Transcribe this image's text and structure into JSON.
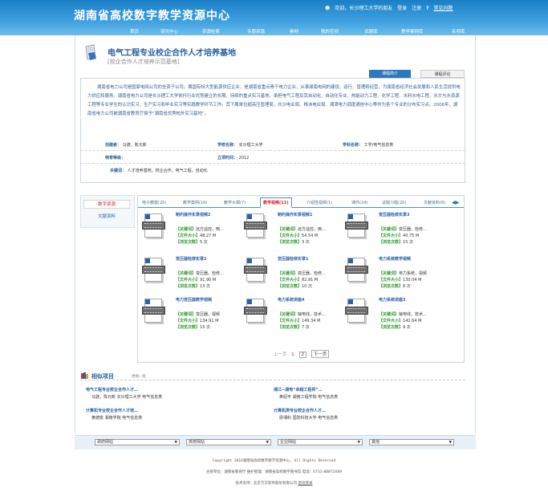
{
  "header": {
    "logo": "湖南省高校数字教学资源中心",
    "welcome": "欢迎，长沙理工大学的朋友",
    "login": "登录",
    "register": "注册",
    "help": "常见问题",
    "nav": [
      "首页",
      "资讯中心",
      "资源检索",
      "专题资源",
      "素材",
      "我的空间",
      "试题库",
      "教学案例库",
      "名师库"
    ]
  },
  "page": {
    "title": "电气工程专业校企合作人才培养基地",
    "subtitle": "[校企合作人才培养示范基地]",
    "tabs": [
      "课程简介",
      "课程评论"
    ]
  },
  "intro": {
    "text": "湖南省电力公司是国家电网公司的全资子公司。属国有特大型能源供应企业，是湖南省重点骨干电力企业，从事湖南电网的建设、运行、管理和经营，为湖南省经济社会发展和人民生活提供电力供应和服务。湖南省电力公司是长沙理工大学依托行业优势建立的长期、持续的重点实习基地，承担电气工程及其自动化、自动化专业、热能动力工程、化学工程、水利水电工程、水文与水资源工程等专业学生的认识实习、生产实习和毕业实习等实践教学环节工作。其下属单位超高压管理局、长沙电业局、株洲电业局、湘潭电力调度通信中心等作为各个专业的分布实习点。2006年，湖南省电力公司被湖南省教育厅授予“湖南省优秀校外实习基地”。",
    "labels": {
      "creator": "创建者：",
      "school": "学校名称：",
      "subject": "学科名称：",
      "grade": "特育等级：",
      "date": "立项时间：",
      "keywords": "关键词："
    },
    "creator": "马骁，陈元新",
    "school": "长沙理工大学",
    "subject": "工学/电气信息类",
    "grade": "",
    "date": "2012",
    "keywords": "人才培养基地，校企合作，电气工程，自动化"
  },
  "left": {
    "items": [
      "数字资源",
      "文献资料"
    ]
  },
  "resource_tabs": [
    "电子教案(25)",
    "教学案例(16)",
    "教学大纲(7)",
    "教学视频(11)",
    "介绍性视频(1)",
    "课件(24)",
    "试题习题(20)",
    "文献资料(6)"
  ],
  "item_labels": {
    "kw": "【关键词】",
    "size": "【文件大小】",
    "views": "【浏览次数】"
  },
  "items": [
    {
      "name": "制约操作实录视频2",
      "kw": "远方遥控，倒…",
      "size": "48.27 M",
      "views": "5 次"
    },
    {
      "name": "制约操作实录视频1",
      "kw": "远方遥控，倒…",
      "size": "54.54 M",
      "views": "3 次"
    },
    {
      "name": "变压器检修实录3",
      "kw": "变压器，检修…",
      "size": "40.75 M",
      "views": "15 次"
    },
    {
      "name": "变压器检修实录2",
      "kw": "变压器，检修…",
      "size": "91.90 M",
      "views": "13 次"
    },
    {
      "name": "变压器检修实录1",
      "kw": "变压器，检修…",
      "size": "82.91 M",
      "views": "10 次"
    },
    {
      "name": "电力系统教学视频",
      "kw": "电力系统，视频",
      "size": "130.04 M",
      "views": "8 次"
    },
    {
      "name": "电力变压器教学视频",
      "kw": "变压器，视频",
      "size": "134.91 M",
      "views": "15 次"
    },
    {
      "name": "电力系统讲座4",
      "kw": "输电线，技术…",
      "size": "149.34 M",
      "views": "7 次"
    },
    {
      "name": "电力系统讲座3",
      "kw": "输电线，技术…",
      "size": "142.64 M",
      "views": "9 次"
    }
  ],
  "pager": {
    "prev": "上一页",
    "p1": "1",
    "p2": "2",
    "next": "下一页"
  },
  "similar": {
    "title": "相似项目",
    "change": "更换一批",
    "items": [
      {
        "title": "电气工程专业校企合作人才…",
        "meta": "马骁，陈元新  长沙理工大学  电气信息类"
      },
      {
        "title": "湘江--湖电“卓越工程师”…",
        "meta": "黄绍平  湖南工程学院  电气信息类"
      },
      {
        "title": "计算机专业校企合作人才培…",
        "meta": "黄德俊  湘南学院  电气信息类"
      },
      {
        "title": "计算机类专业校企合作人才…",
        "meta": "廖湘科  国防科技大学  电气信息类"
      }
    ]
  },
  "footer": {
    "selects": [
      "政府网站",
      "高校网站",
      "企业网站",
      "其他"
    ],
    "copyright": "Copyright 2014湖南省高校数字教学资源中心, All Rights Reserved",
    "admin": "主管单位：湖南省教育厅  维护管理：湖南省高校数字图书馆  电话：0731-88872069",
    "tech": "技术支持：北京万方软件股份有限公司",
    "login": "后台登录"
  },
  "colors": {
    "header": "#2d8fd6",
    "accent": "#2d77bd",
    "red": "#d81e1e",
    "green": "#2f9a2f"
  }
}
